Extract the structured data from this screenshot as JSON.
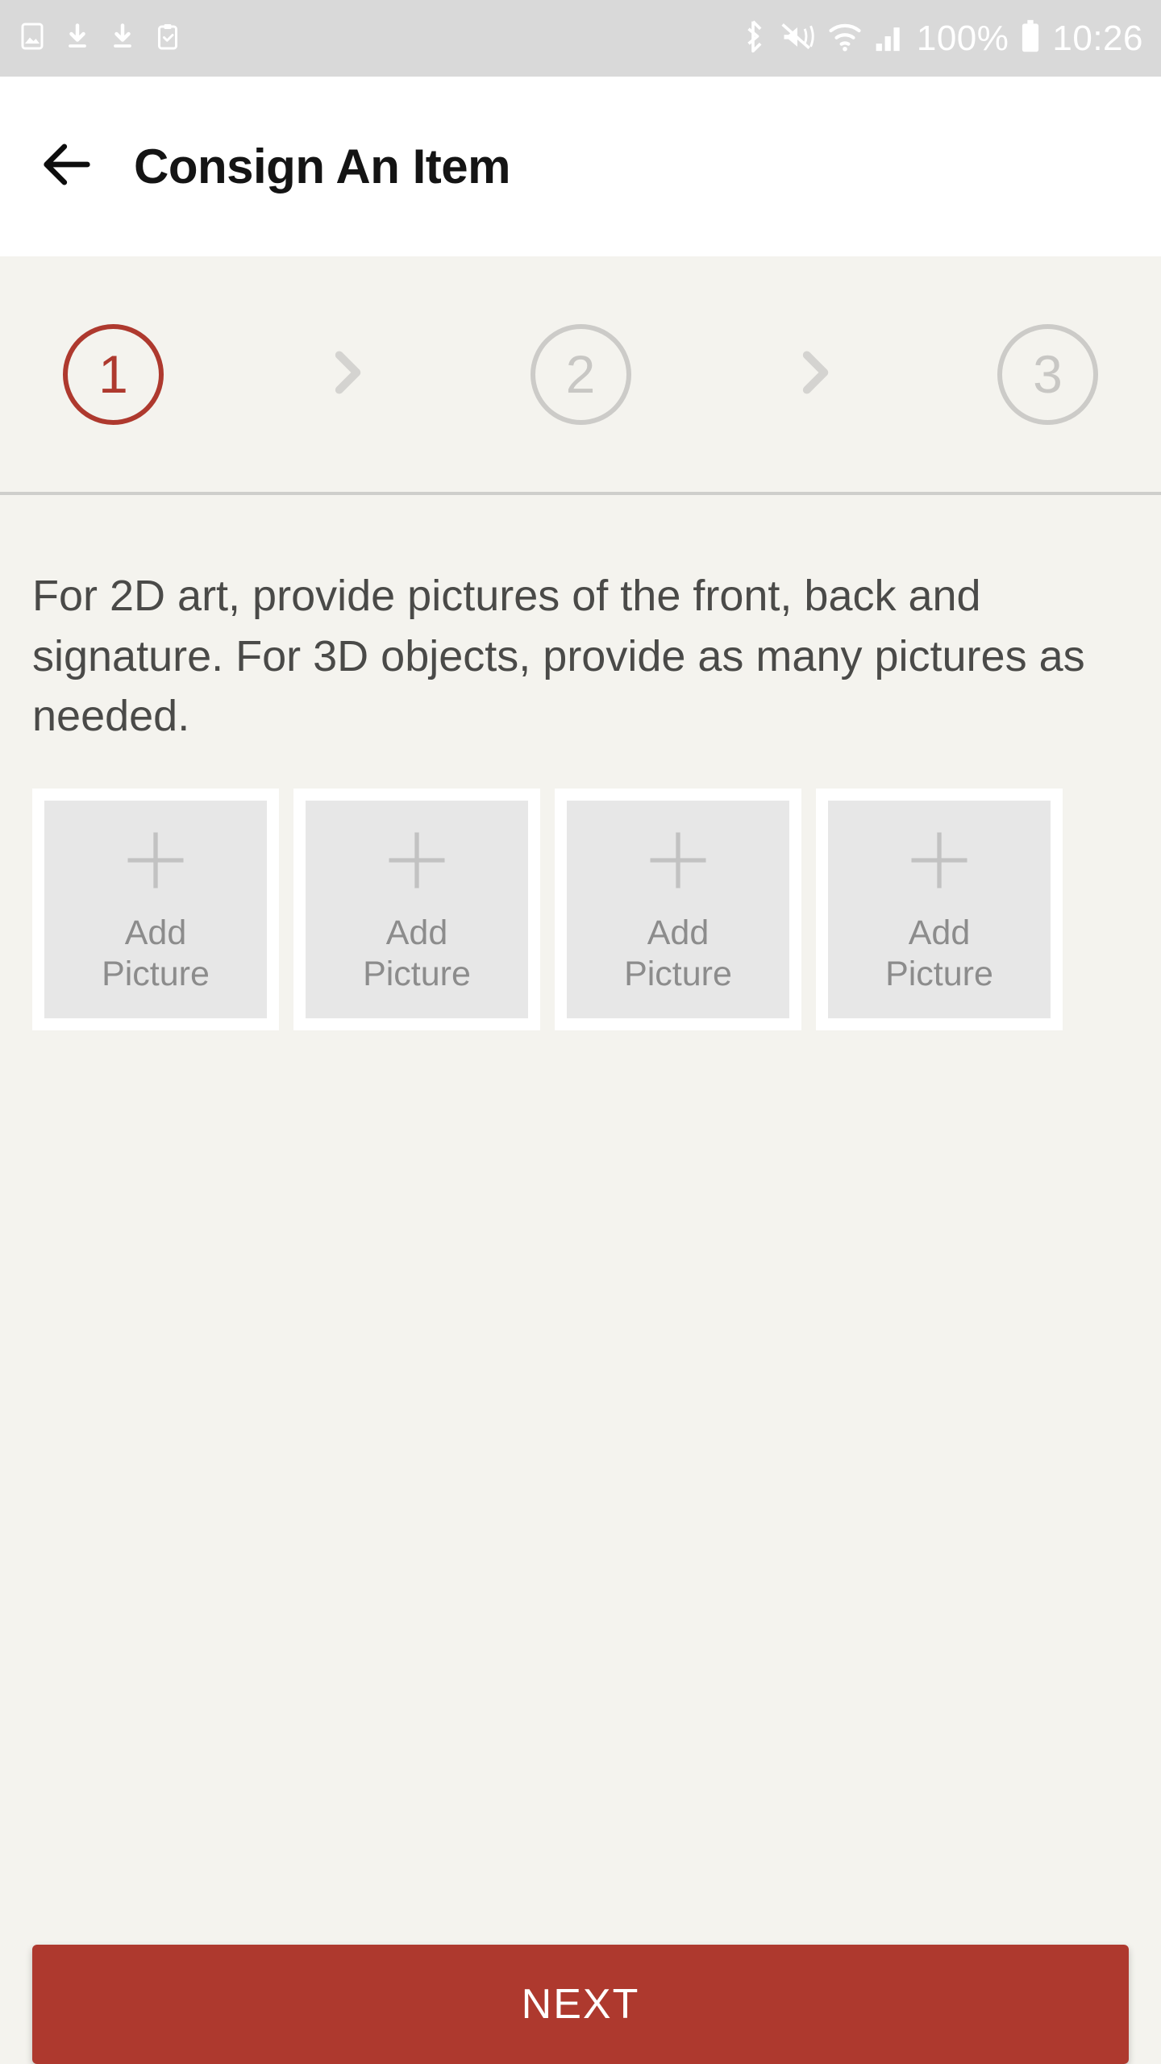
{
  "status_bar": {
    "left_icons": [
      "image-icon",
      "download-icon",
      "download-icon",
      "clipboard-check-icon"
    ],
    "right_icons": [
      "bluetooth-icon",
      "vibrate-mute-icon",
      "wifi-icon",
      "signal-icon",
      "battery-icon"
    ],
    "battery_percent": "100%",
    "time": "10:26",
    "background": "#D9D9D9",
    "icon_color": "#FFFFFF"
  },
  "header": {
    "back_icon": "back-arrow-icon",
    "title": "Consign An Item",
    "background": "#FFFFFF"
  },
  "stepper": {
    "steps": [
      {
        "label": "1",
        "state": "active"
      },
      {
        "label": "2",
        "state": "inactive"
      },
      {
        "label": "3",
        "state": "inactive"
      }
    ],
    "separator_icon": "chevron-right-icon",
    "active_color": "#AE392E",
    "inactive_color": "#CCCBC8"
  },
  "main": {
    "instructions": "For 2D art, provide pictures of the front, back and signature. For 3D objects, provide as many pictures as needed.",
    "tiles": [
      {
        "icon": "plus-icon",
        "label_line1": "Add",
        "label_line2": "Picture"
      },
      {
        "icon": "plus-icon",
        "label_line1": "Add",
        "label_line2": "Picture"
      },
      {
        "icon": "plus-icon",
        "label_line1": "Add",
        "label_line2": "Picture"
      },
      {
        "icon": "plus-icon",
        "label_line1": "Add",
        "label_line2": "Picture"
      }
    ],
    "background": "#F4F3EE"
  },
  "footer": {
    "next_label": "NEXT",
    "next_color": "#AE392E"
  }
}
